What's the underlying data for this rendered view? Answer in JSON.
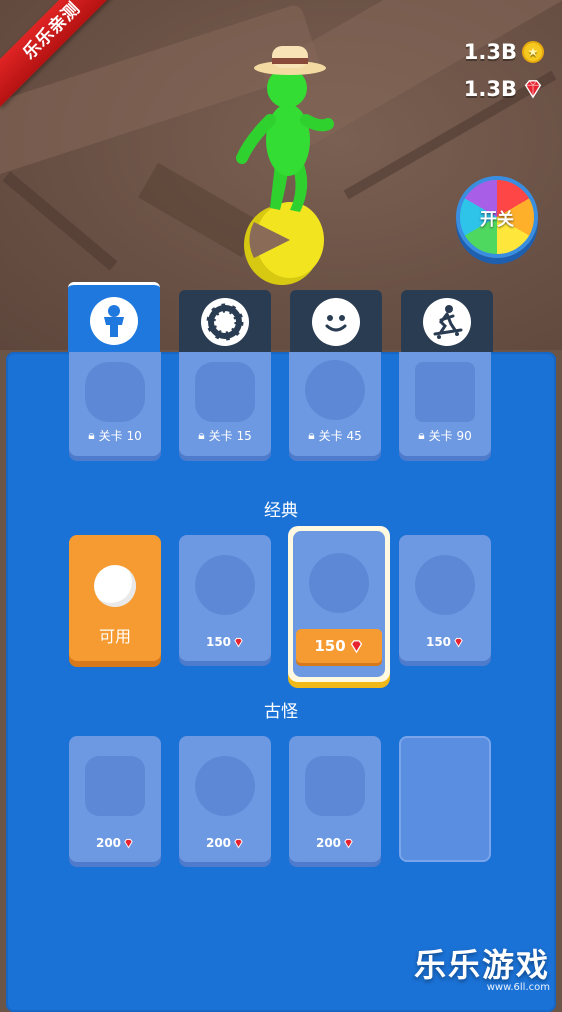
{
  "badge": {
    "text": "乐乐亲测"
  },
  "currency": {
    "coins": "1.3B",
    "gems": "1.3B"
  },
  "wheel": {
    "label": "开关"
  },
  "tabs": [
    {
      "icon": "body-icon",
      "active": true
    },
    {
      "icon": "ring-icon",
      "active": false
    },
    {
      "icon": "smiley-face-icon",
      "active": false
    },
    {
      "icon": "skateboard-icon",
      "active": false
    }
  ],
  "locked_items": [
    {
      "label": "关卡 10"
    },
    {
      "label": "关卡 15"
    },
    {
      "label": "关卡 45"
    },
    {
      "label": "关卡 90"
    }
  ],
  "sections": {
    "classic": {
      "title": "经典",
      "items": [
        {
          "type": "available",
          "label": "可用"
        },
        {
          "type": "price",
          "price": "150"
        },
        {
          "type": "selected",
          "price": "150"
        },
        {
          "type": "price",
          "price": "150"
        }
      ]
    },
    "quirky": {
      "title": "古怪",
      "items": [
        {
          "price": "200"
        },
        {
          "price": "200"
        },
        {
          "price": "200"
        }
      ]
    }
  },
  "watermark": {
    "title": "乐乐游戏",
    "url": "www.6ll.com"
  },
  "colors": {
    "panel": "#1b72d6",
    "accent": "#f59b32",
    "gem": "#e8222e",
    "coin": "#f6c920"
  }
}
